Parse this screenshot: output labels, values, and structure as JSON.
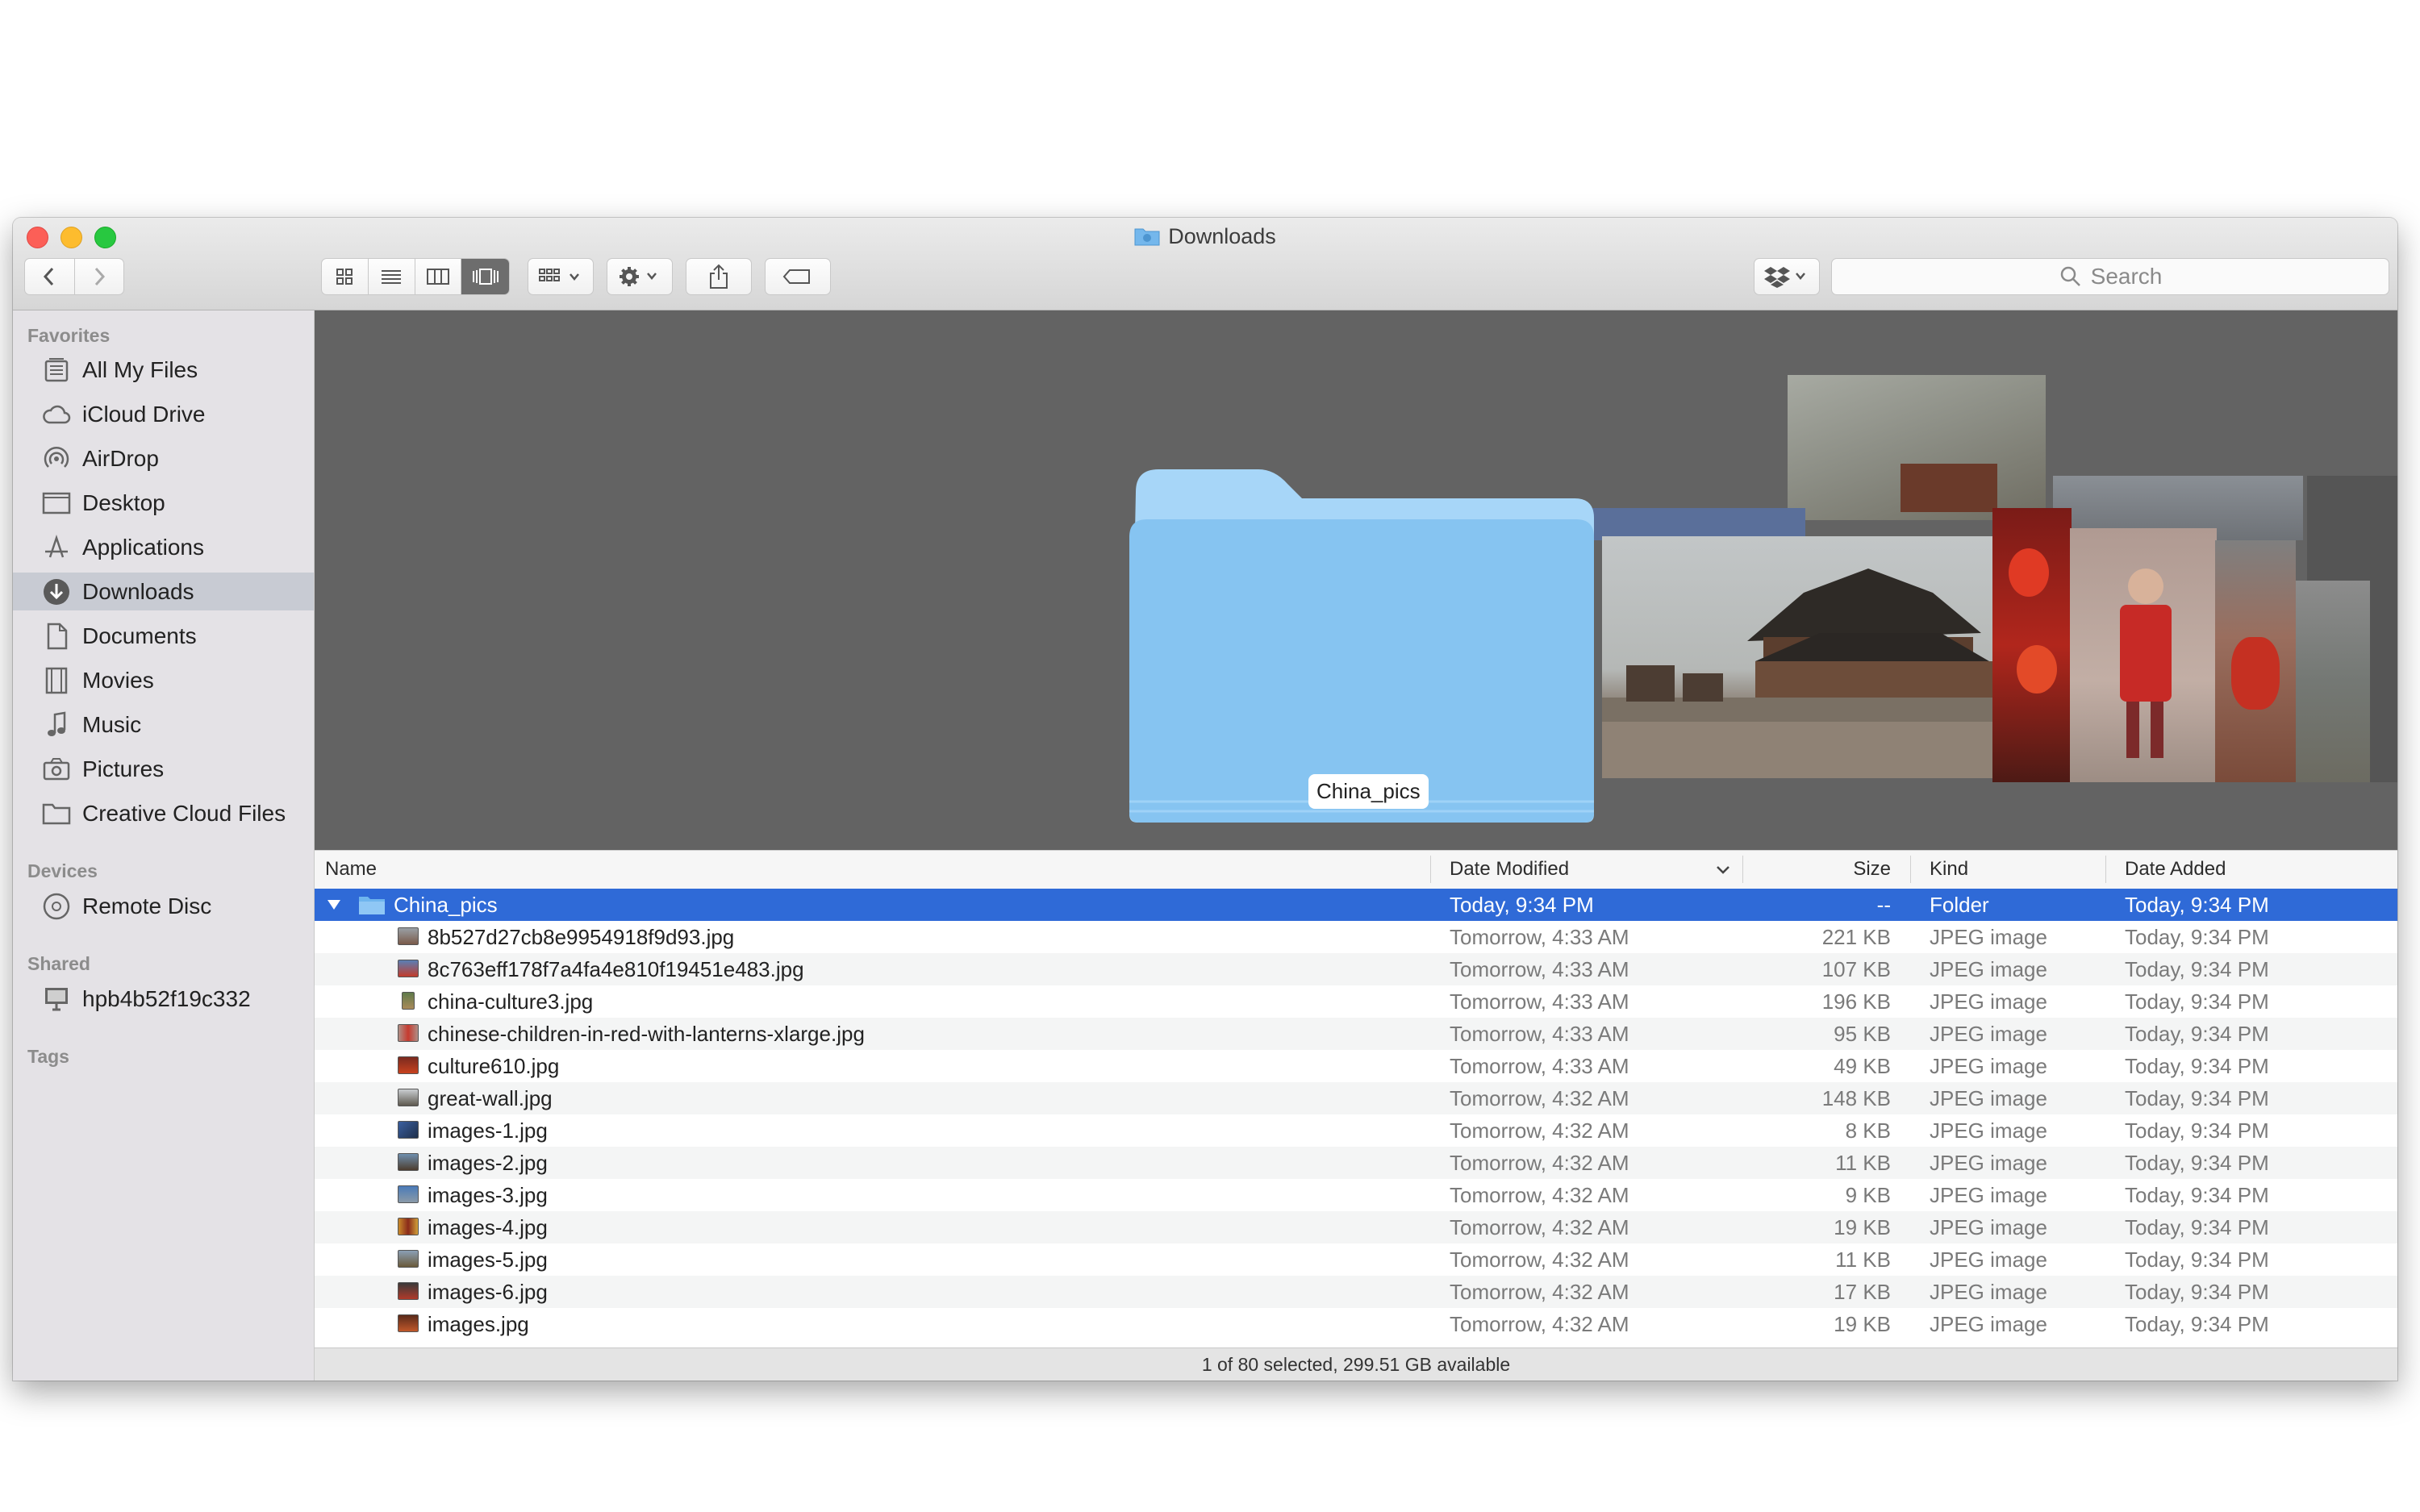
{
  "window": {
    "title": "Downloads"
  },
  "toolbar": {
    "back": "back-chevron-icon",
    "forward": "forward-chevron-icon",
    "view_modes": [
      "icon-view",
      "list-view",
      "column-view",
      "cover-flow-view"
    ],
    "active_view": "cover-flow-view",
    "search_placeholder": "Search"
  },
  "sidebar": {
    "favorites_label": "Favorites",
    "favorites": [
      {
        "label": "All My Files",
        "icon": "all-files-icon"
      },
      {
        "label": "iCloud Drive",
        "icon": "cloud-icon"
      },
      {
        "label": "AirDrop",
        "icon": "airdrop-icon"
      },
      {
        "label": "Desktop",
        "icon": "desktop-icon"
      },
      {
        "label": "Applications",
        "icon": "applications-icon"
      },
      {
        "label": "Downloads",
        "icon": "download-icon"
      },
      {
        "label": "Documents",
        "icon": "document-icon"
      },
      {
        "label": "Movies",
        "icon": "film-icon"
      },
      {
        "label": "Music",
        "icon": "music-note-icon"
      },
      {
        "label": "Pictures",
        "icon": "camera-icon"
      },
      {
        "label": "Creative Cloud Files",
        "icon": "folder-icon"
      }
    ],
    "selected": "Downloads",
    "devices_label": "Devices",
    "devices": [
      {
        "label": "Remote Disc",
        "icon": "disc-icon"
      }
    ],
    "shared_label": "Shared",
    "shared": [
      {
        "label": "hpb4b52f19c332",
        "icon": "monitor-icon"
      }
    ],
    "tags_label": "Tags"
  },
  "preview": {
    "folder_label": "China_pics"
  },
  "columns": {
    "name": "Name",
    "date_modified": "Date Modified",
    "size": "Size",
    "kind": "Kind",
    "date_added": "Date Added"
  },
  "rows": [
    {
      "name": "China_pics",
      "date_modified": "Today, 9:34 PM",
      "size": "--",
      "kind": "Folder",
      "date_added": "Today, 9:34 PM",
      "selected": true,
      "folder": true
    },
    {
      "name": "8b527d27cb8e9954918f9d93.jpg",
      "date_modified": "Tomorrow, 4:33 AM",
      "size": "221 KB",
      "kind": "JPEG image",
      "date_added": "Today, 9:34 PM"
    },
    {
      "name": "8c763eff178f7a4fa4e810f19451e483.jpg",
      "date_modified": "Tomorrow, 4:33 AM",
      "size": "107 KB",
      "kind": "JPEG image",
      "date_added": "Today, 9:34 PM"
    },
    {
      "name": "china-culture3.jpg",
      "date_modified": "Tomorrow, 4:33 AM",
      "size": "196 KB",
      "kind": "JPEG image",
      "date_added": "Today, 9:34 PM"
    },
    {
      "name": "chinese-children-in-red-with-lanterns-xlarge.jpg",
      "date_modified": "Tomorrow, 4:33 AM",
      "size": "95 KB",
      "kind": "JPEG image",
      "date_added": "Today, 9:34 PM"
    },
    {
      "name": "culture610.jpg",
      "date_modified": "Tomorrow, 4:33 AM",
      "size": "49 KB",
      "kind": "JPEG image",
      "date_added": "Today, 9:34 PM"
    },
    {
      "name": "great-wall.jpg",
      "date_modified": "Tomorrow, 4:32 AM",
      "size": "148 KB",
      "kind": "JPEG image",
      "date_added": "Today, 9:34 PM"
    },
    {
      "name": "images-1.jpg",
      "date_modified": "Tomorrow, 4:32 AM",
      "size": "8 KB",
      "kind": "JPEG image",
      "date_added": "Today, 9:34 PM"
    },
    {
      "name": "images-2.jpg",
      "date_modified": "Tomorrow, 4:32 AM",
      "size": "11 KB",
      "kind": "JPEG image",
      "date_added": "Today, 9:34 PM"
    },
    {
      "name": "images-3.jpg",
      "date_modified": "Tomorrow, 4:32 AM",
      "size": "9 KB",
      "kind": "JPEG image",
      "date_added": "Today, 9:34 PM"
    },
    {
      "name": "images-4.jpg",
      "date_modified": "Tomorrow, 4:32 AM",
      "size": "19 KB",
      "kind": "JPEG image",
      "date_added": "Today, 9:34 PM"
    },
    {
      "name": "images-5.jpg",
      "date_modified": "Tomorrow, 4:32 AM",
      "size": "11 KB",
      "kind": "JPEG image",
      "date_added": "Today, 9:34 PM"
    },
    {
      "name": "images-6.jpg",
      "date_modified": "Tomorrow, 4:32 AM",
      "size": "17 KB",
      "kind": "JPEG image",
      "date_added": "Today, 9:34 PM"
    },
    {
      "name": "images.jpg",
      "date_modified": "Tomorrow, 4:32 AM",
      "size": "19 KB",
      "kind": "JPEG image",
      "date_added": "Today, 9:34 PM"
    }
  ],
  "status": "1 of 80 selected, 299.51 GB available",
  "colors": {
    "selection": "#2f6ad7",
    "folder_blue": "#7cc0f2",
    "preview_bg": "#636363"
  }
}
